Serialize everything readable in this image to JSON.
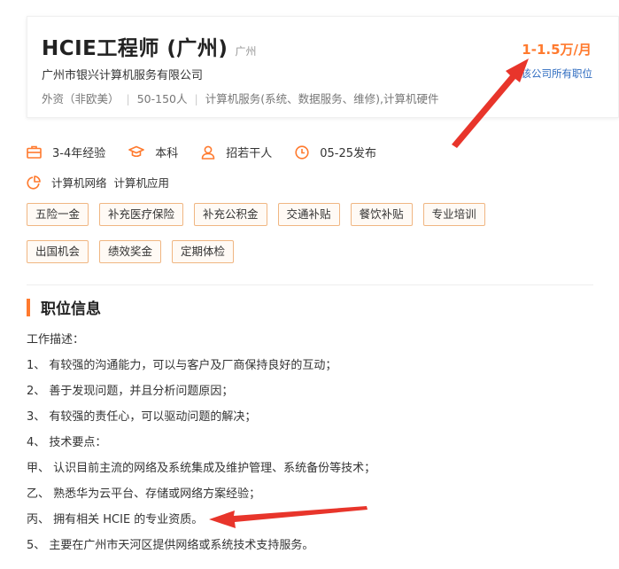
{
  "job": {
    "title": "HCIE工程师 (广州)",
    "city": "广州",
    "company": "广州市银兴计算机服务有限公司",
    "meta": {
      "company_type": "外资（非欧美）",
      "size": "50-150人",
      "industry": "计算机服务(系统、数据服务、维修),计算机硬件"
    },
    "salary": "1-1.5万/月",
    "all_jobs_link": "该公司所有职位"
  },
  "requirements": {
    "experience": "3-4年经验",
    "education": "本科",
    "headcount": "招若干人",
    "posted": "05-25发布"
  },
  "category": "计算机网络  计算机应用",
  "benefits": [
    "五险一金",
    "补充医疗保险",
    "补充公积金",
    "交通补贴",
    "餐饮补贴",
    "专业培训",
    "出国机会",
    "绩效奖金",
    "定期体检"
  ],
  "section": {
    "title": "职位信息",
    "lines": [
      "工作描述：",
      "1、 有较强的沟通能力，可以与客户及厂商保持良好的互动；",
      "2、 善于发现问题，并且分析问题原因；",
      "3、 有较强的责任心，可以驱动问题的解决；",
      "4、 技术要点：",
      "甲、 认识目前主流的网络及系统集成及维护管理、系统备份等技术；",
      "乙、 熟悉华为云平台、存储或网络方案经验；",
      "丙、 拥有相关 HCIE 的专业资质。",
      "5、 主要在广州市天河区提供网络或系统技术支持服务。"
    ]
  },
  "colors": {
    "accent": "#ff7a2e",
    "link": "#2f6cc0",
    "tag_border": "#f0b682",
    "arrow": "#e8352b"
  },
  "icons": [
    "briefcase-icon",
    "graduation-cap-icon",
    "person-icon",
    "clock-icon",
    "pie-chart-icon",
    "red-arrow-annotation"
  ]
}
